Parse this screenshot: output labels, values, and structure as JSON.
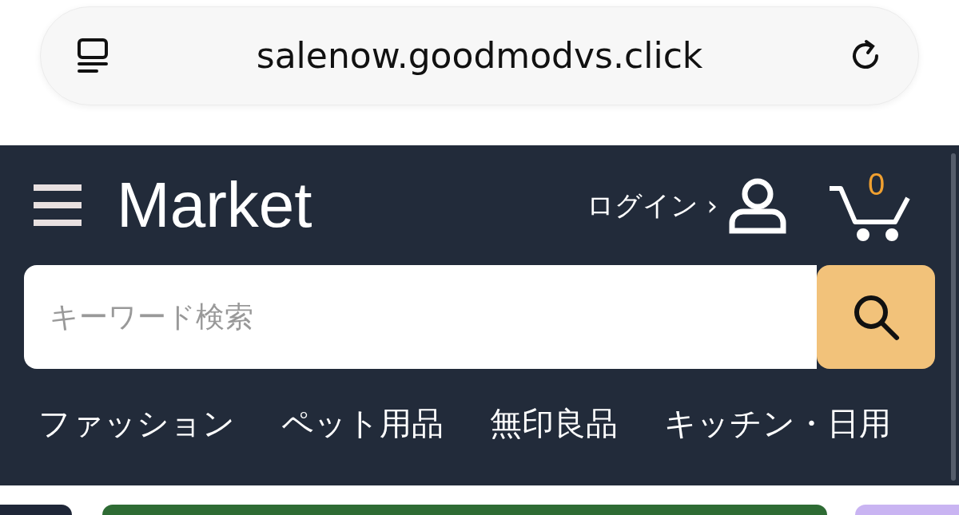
{
  "address_bar": {
    "url": "salenow.goodmodvs.click"
  },
  "header": {
    "logo": "Market",
    "login_link": "ログイン ›",
    "cart_count": "0"
  },
  "search": {
    "placeholder": "キーワード検索"
  },
  "categories": [
    "ファッション",
    "ペット用品",
    "無印良品",
    "キッチン・日用"
  ]
}
